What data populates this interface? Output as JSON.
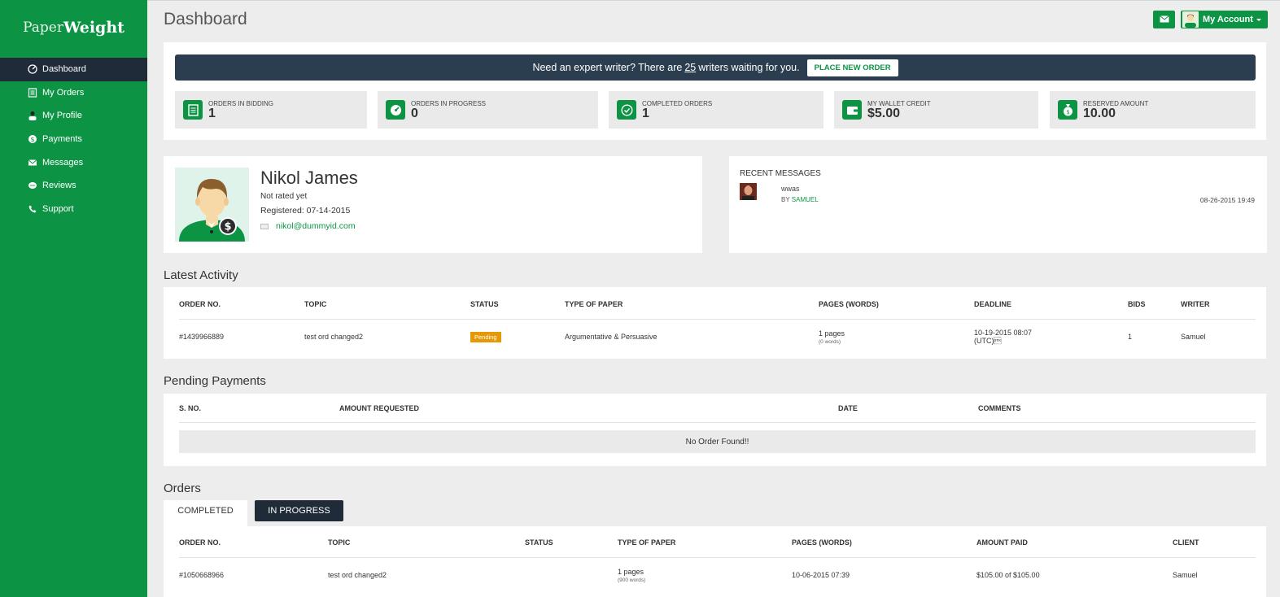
{
  "brand": {
    "part1": "Paper",
    "part2": "Weight"
  },
  "sidebar": {
    "items": [
      {
        "label": "Dashboard",
        "icon": "dashboard-icon",
        "active": true
      },
      {
        "label": "My Orders",
        "icon": "orders-icon"
      },
      {
        "label": "My Profile",
        "icon": "profile-icon"
      },
      {
        "label": "Payments",
        "icon": "payments-icon"
      },
      {
        "label": "Messages",
        "icon": "messages-icon"
      },
      {
        "label": "Reviews",
        "icon": "reviews-icon"
      },
      {
        "label": "Support",
        "icon": "support-icon"
      }
    ]
  },
  "header": {
    "title": "Dashboard",
    "account_label": "My Account"
  },
  "banner": {
    "text_before": "Need an expert writer? There are",
    "count": "25",
    "text_after": "writers waiting for you.",
    "button": "PLACE NEW ORDER"
  },
  "stats": [
    {
      "label": "ORDERS IN BIDDING",
      "value": "1"
    },
    {
      "label": "ORDERS IN PROGRESS",
      "value": "0"
    },
    {
      "label": "COMPLETED ORDERS",
      "value": "1"
    },
    {
      "label": "MY WALLET CREDIT",
      "value": "$5.00"
    },
    {
      "label": "RESERVED AMOUNT",
      "value": "10.00"
    }
  ],
  "profile": {
    "name": "Nikol James",
    "rating": "Not rated yet",
    "registered": "Registered: 07-14-2015",
    "email": "nikol@dummyid.com"
  },
  "messages": {
    "title": "RECENT MESSAGES",
    "items": [
      {
        "text": "wwas",
        "by_prefix": "BY",
        "by": "SAMUEL",
        "date": "08-26-2015 19:49"
      }
    ]
  },
  "latest_activity": {
    "title": "Latest Activity",
    "columns": [
      "ORDER NO.",
      "TOPIC",
      "STATUS",
      "TYPE OF PAPER",
      "PAGES (WORDS)",
      "DEADLINE",
      "BIDS",
      "WRITER"
    ],
    "row": {
      "order": "#1439966889",
      "topic": "test ord changed2",
      "status": "Pending",
      "type": "Argumentative & Persuasive",
      "pages": "1 pages",
      "words": "(0 words)",
      "deadline": "10-19-2015 08:07",
      "deadline_tz": "(UTC)\u0002",
      "bids": "1",
      "writer": "Samuel"
    }
  },
  "pending_payments": {
    "title": "Pending Payments",
    "columns": [
      "S. NO.",
      "AMOUNT REQUESTED",
      "DATE",
      "COMMENTS"
    ],
    "empty": "No Order Found!!"
  },
  "orders": {
    "title": "Orders",
    "tabs": [
      "COMPLETED",
      "IN PROGRESS"
    ],
    "columns": [
      "ORDER NO.",
      "TOPIC",
      "STATUS",
      "TYPE OF PAPER",
      "PAGES (WORDS)",
      "AMOUNT PAID",
      "CLIENT"
    ],
    "row": {
      "order": "#1050668966",
      "topic": "test ord changed2",
      "status": "",
      "pages": "1 pages",
      "words": "(900 words)",
      "date": "10-06-2015 07:39",
      "amount": "$105.00 of $105.00",
      "client": "Samuel"
    }
  },
  "colors": {
    "brand_green": "#0c9444",
    "dark_navy": "#1f2b38",
    "banner_bg": "#2b3e50",
    "pending": "#e59a05"
  }
}
